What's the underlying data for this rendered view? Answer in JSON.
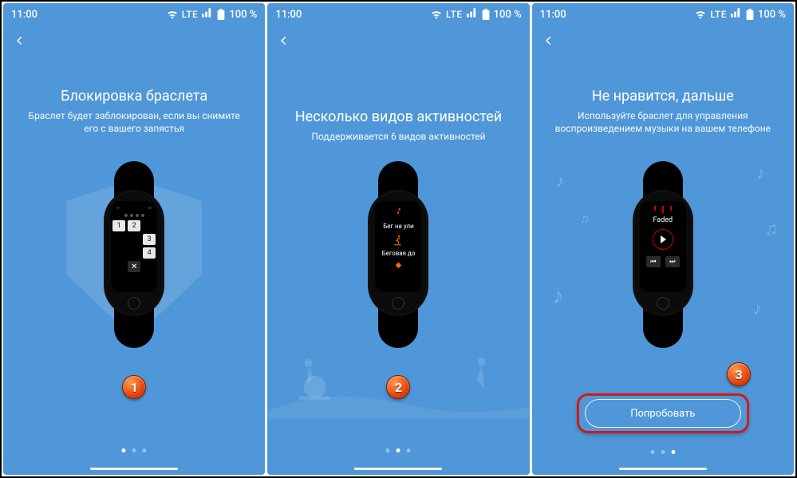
{
  "status": {
    "time": "11:00",
    "network": "LTE",
    "battery": "100 %"
  },
  "panels": [
    {
      "title": "Блокировка браслета",
      "subtitle": "Браслет будет заблокирован, если вы снимите его с вашего запястья",
      "badge": "1",
      "pin": {
        "top_left": "←",
        "top_right": "↔",
        "keys": [
          "1",
          "2",
          "",
          "",
          "",
          "3",
          "",
          "",
          "4"
        ],
        "del": "✕"
      }
    },
    {
      "title": "Несколько видов активностей",
      "subtitle": "Поддерживается 6 видов активностей",
      "badge": "2",
      "activities": [
        {
          "label": "Бег на ули"
        },
        {
          "label": "Беговая до"
        }
      ]
    },
    {
      "title": "Не нравится, дальше",
      "subtitle": "Используйте браслет для управления воспроизведением музыки на вашем телефоне",
      "badge": "3",
      "music": {
        "track": "Faded",
        "prev": "⏮",
        "next": "⏭"
      },
      "try_label": "Попробовать"
    }
  ]
}
